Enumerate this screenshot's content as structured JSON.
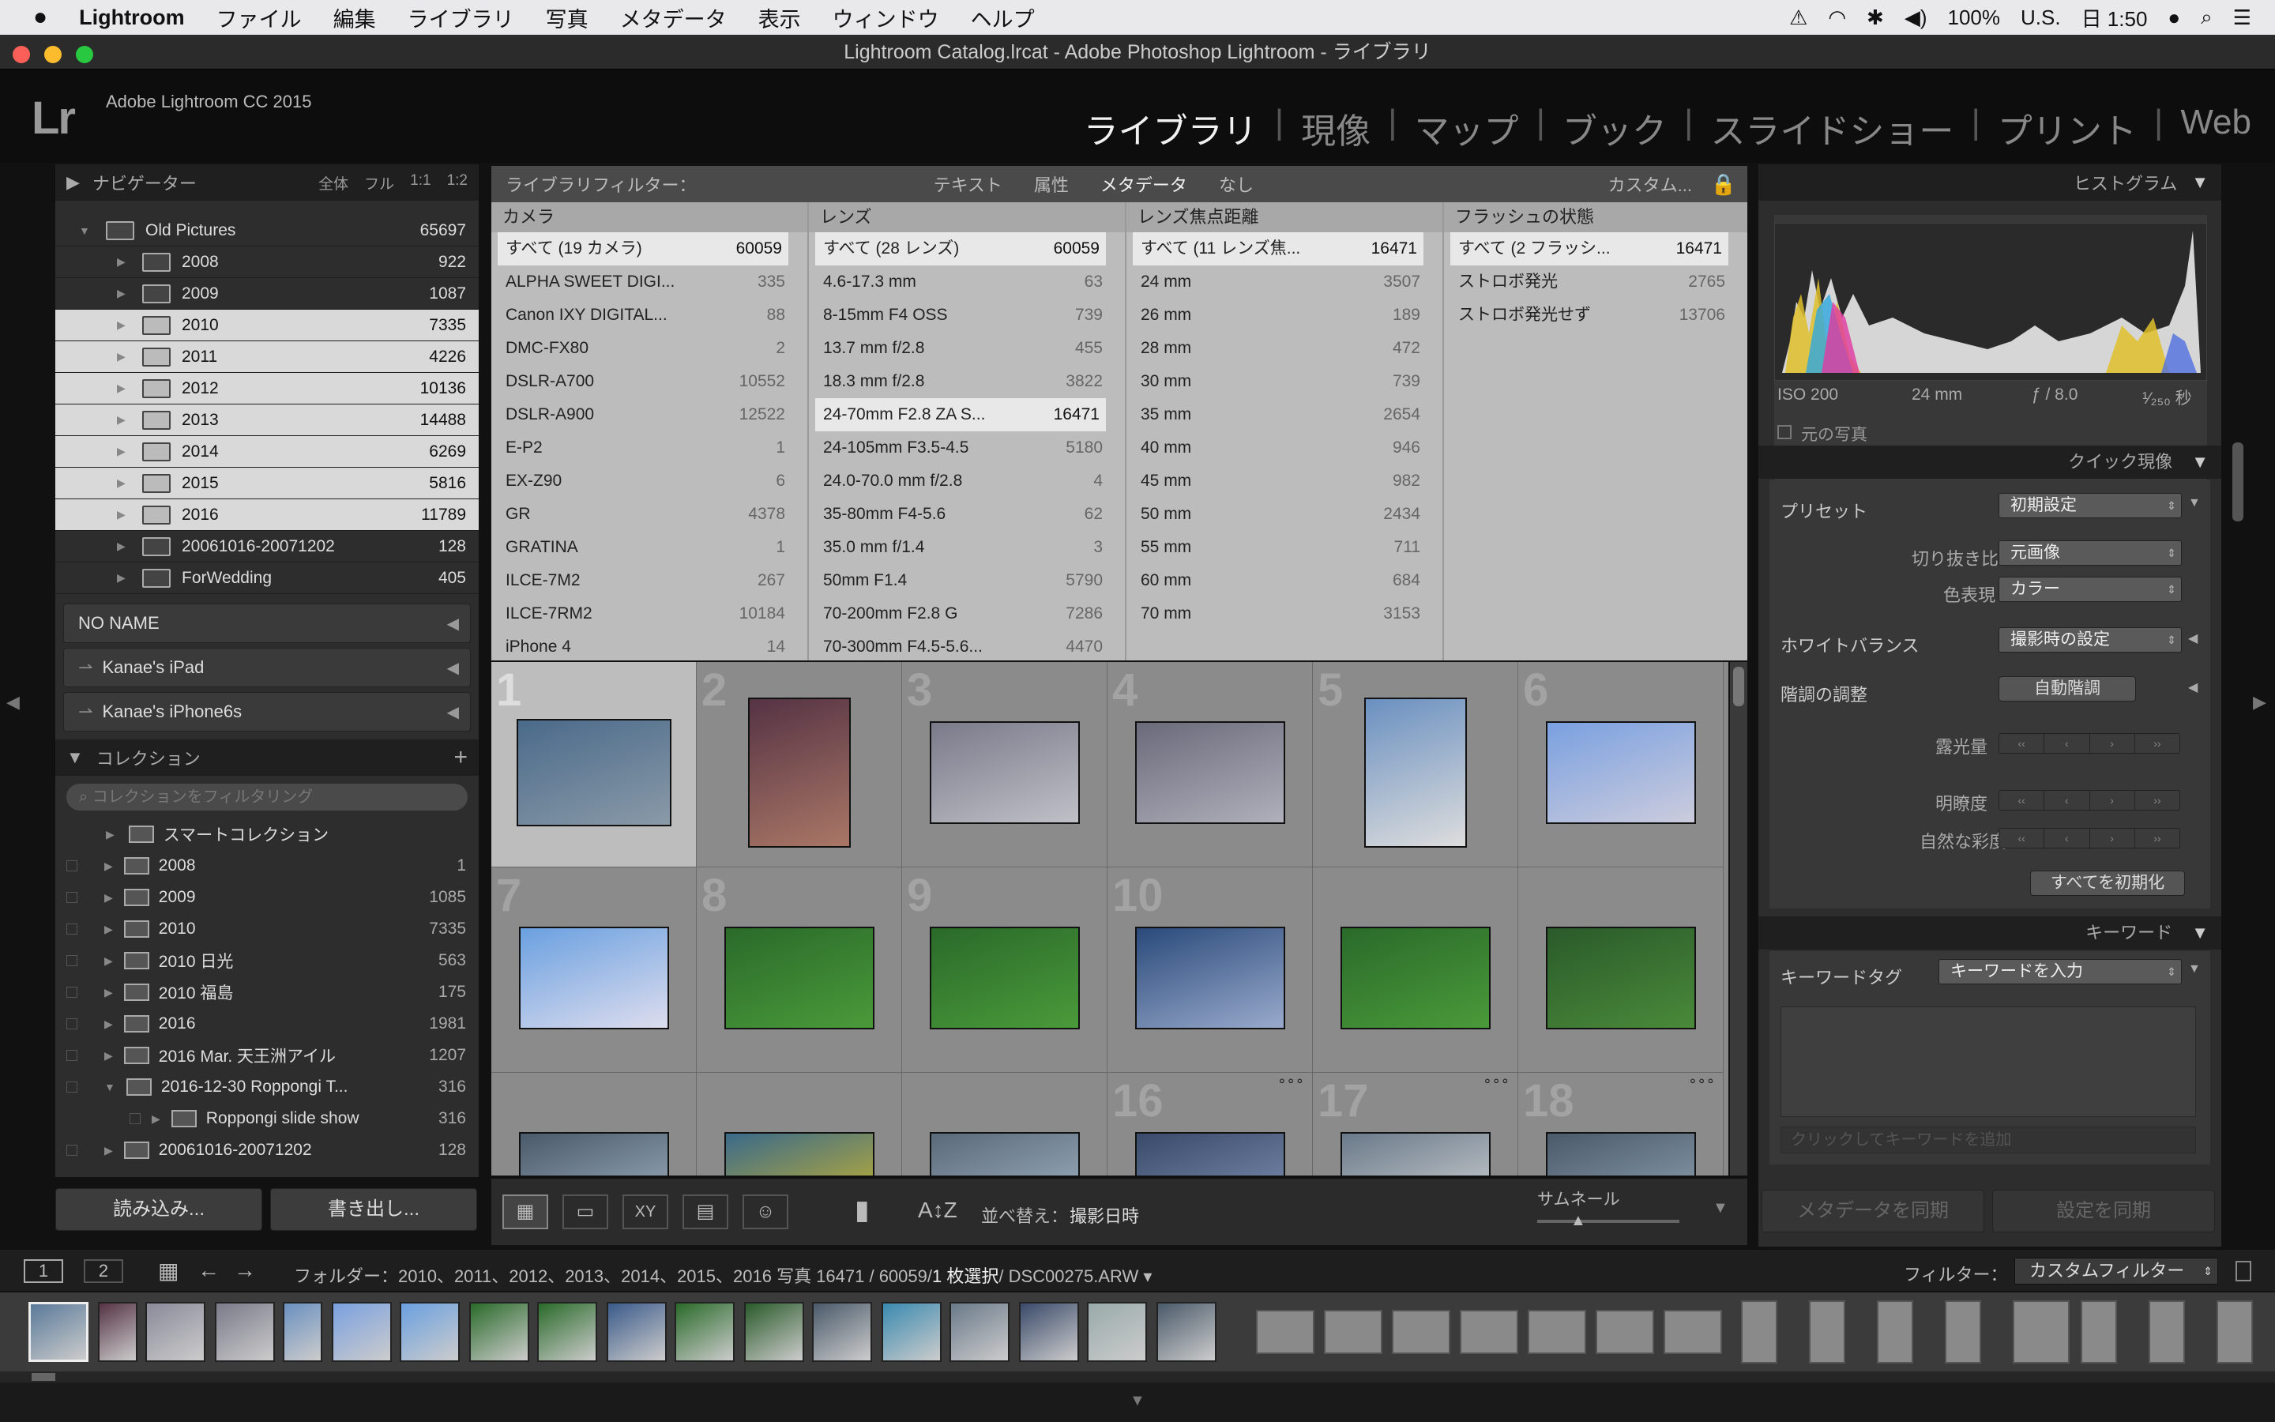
{
  "menubar": {
    "app": "Lightroom",
    "items": [
      "ファイル",
      "編集",
      "ライブラリ",
      "写真",
      "メタデータ",
      "表示",
      "ウィンドウ",
      "ヘルプ"
    ],
    "battery": "100%",
    "input": "U.S.",
    "clock": "日 1:50"
  },
  "window": {
    "title": "Lightroom Catalog.lrcat - Adobe Photoshop Lightroom - ライブラリ"
  },
  "header": {
    "logo": "Lr",
    "product": "Adobe Lightroom CC 2015",
    "modules": [
      "ライブラリ",
      "現像",
      "マップ",
      "ブック",
      "スライドショー",
      "プリント",
      "Web"
    ],
    "active_module": "ライブラリ"
  },
  "navigator": {
    "label": "ナビゲーター",
    "zoom": [
      "全体",
      "フル",
      "1:1",
      "1:2"
    ]
  },
  "folders": {
    "root": {
      "name": "Old Pictures",
      "count": "65697"
    },
    "items": [
      {
        "name": "2008",
        "count": "922",
        "hl": false
      },
      {
        "name": "2009",
        "count": "1087",
        "hl": false
      },
      {
        "name": "2010",
        "count": "7335",
        "hl": true
      },
      {
        "name": "2011",
        "count": "4226",
        "hl": true
      },
      {
        "name": "2012",
        "count": "10136",
        "hl": true
      },
      {
        "name": "2013",
        "count": "14488",
        "hl": true
      },
      {
        "name": "2014",
        "count": "6269",
        "hl": true
      },
      {
        "name": "2015",
        "count": "5816",
        "hl": true
      },
      {
        "name": "2016",
        "count": "11789",
        "hl": true
      },
      {
        "name": "20061016-20071202",
        "count": "128",
        "hl": false
      },
      {
        "name": "ForWedding",
        "count": "405",
        "hl": false
      }
    ],
    "volumes": [
      "NO NAME",
      "Kanae's iPad",
      "Kanae's iPhone6s"
    ]
  },
  "collections": {
    "label": "コレクション",
    "filter_placeholder": "コレクションをフィルタリング",
    "smart": "スマートコレクション",
    "items": [
      {
        "name": "2008",
        "count": "1"
      },
      {
        "name": "2009",
        "count": "1085"
      },
      {
        "name": "2010",
        "count": "7335"
      },
      {
        "name": "2010 日光",
        "count": "563"
      },
      {
        "name": "2010 福島",
        "count": "175"
      },
      {
        "name": "2016",
        "count": "1981"
      },
      {
        "name": "2016 Mar. 天王洲アイル",
        "count": "1207"
      },
      {
        "name": "2016-12-30 Roppongi T...",
        "count": "316"
      },
      {
        "name": "Roppongi slide show",
        "count": "316"
      },
      {
        "name": "20061016-20071202",
        "count": "128"
      }
    ]
  },
  "left_buttons": {
    "import": "読み込み...",
    "export": "書き出し..."
  },
  "filterbar": {
    "label": "ライブラリフィルター：",
    "tabs": [
      "テキスト",
      "属性",
      "メタデータ",
      "なし"
    ],
    "active": "メタデータ",
    "preset": "カスタム..."
  },
  "metadata": {
    "camera": {
      "header": "カメラ",
      "rows": [
        [
          "すべて (19 カメラ)",
          "60059"
        ],
        [
          "ALPHA SWEET DIGI...",
          "335"
        ],
        [
          "Canon IXY DIGITAL...",
          "88"
        ],
        [
          "DMC-FX80",
          "2"
        ],
        [
          "DSLR-A700",
          "10552"
        ],
        [
          "DSLR-A900",
          "12522"
        ],
        [
          "E-P2",
          "1"
        ],
        [
          "EX-Z90",
          "6"
        ],
        [
          "GR",
          "4378"
        ],
        [
          "GRATINA",
          "1"
        ],
        [
          "ILCE-7M2",
          "267"
        ],
        [
          "ILCE-7RM2",
          "10184"
        ],
        [
          "iPhone 4",
          "14"
        ]
      ]
    },
    "lens": {
      "header": "レンズ",
      "rows": [
        [
          "すべて (28 レンズ)",
          "60059"
        ],
        [
          "4.6-17.3 mm",
          "63"
        ],
        [
          "8-15mm F4 OSS",
          "739"
        ],
        [
          "13.7 mm f/2.8",
          "455"
        ],
        [
          "18.3 mm f/2.8",
          "3822"
        ],
        [
          "24-70mm F2.8 ZA S...",
          "16471"
        ],
        [
          "24-105mm F3.5-4.5",
          "5180"
        ],
        [
          "24.0-70.0 mm f/2.8",
          "4"
        ],
        [
          "35-80mm F4-5.6",
          "62"
        ],
        [
          "35.0 mm f/1.4",
          "3"
        ],
        [
          "50mm F1.4",
          "5790"
        ],
        [
          "70-200mm F2.8 G",
          "7286"
        ],
        [
          "70-300mm F4.5-5.6...",
          "4470"
        ]
      ]
    },
    "focal": {
      "header": "レンズ焦点距離",
      "rows": [
        [
          "すべて (11 レンズ焦...",
          "16471"
        ],
        [
          "24 mm",
          "3507"
        ],
        [
          "26 mm",
          "189"
        ],
        [
          "28 mm",
          "472"
        ],
        [
          "30 mm",
          "739"
        ],
        [
          "35 mm",
          "2654"
        ],
        [
          "40 mm",
          "946"
        ],
        [
          "45 mm",
          "982"
        ],
        [
          "50 mm",
          "2434"
        ],
        [
          "55 mm",
          "711"
        ],
        [
          "60 mm",
          "684"
        ],
        [
          "70 mm",
          "3153"
        ]
      ]
    },
    "flash": {
      "header": "フラッシュの状態",
      "rows": [
        [
          "すべて (2 フラッシ...",
          "16471"
        ],
        [
          "ストロボ発光",
          "2765"
        ],
        [
          "ストロボ発光せず",
          "13706"
        ]
      ]
    }
  },
  "grid_numbers": [
    "1",
    "2",
    "3",
    "4",
    "5",
    "6",
    "7",
    "8",
    "9",
    "10",
    "",
    "",
    "",
    "",
    "",
    "16",
    "17",
    "18"
  ],
  "toolbar": {
    "sort_label": "並べ替え：",
    "sort_value": "撮影日時",
    "thumb_label": "サムネール"
  },
  "right": {
    "histogram": "ヒストグラム",
    "exif": {
      "iso": "ISO 200",
      "focal": "24 mm",
      "aperture": "ƒ / 8.0",
      "shutter": "¹⁄₂₅₀ 秒"
    },
    "original": "元の写真",
    "quick_develop": "クイック現像",
    "preset_label": "プリセット",
    "preset_value": "初期設定",
    "crop_label": "切り抜き比",
    "crop_value": "元画像",
    "treatment_label": "色表現",
    "treatment_value": "カラー",
    "wb_label": "ホワイトバランス",
    "wb_value": "撮影時の設定",
    "tone_label": "階調の調整",
    "auto_tone": "自動階調",
    "exposure": "露光量",
    "clarity": "明瞭度",
    "vibrance": "自然な彩度",
    "reset_all": "すべてを初期化",
    "keywording": "キーワード",
    "keyword_tags": "キーワードタグ",
    "keyword_select": "キーワードを入力",
    "keyword_add_placeholder": "クリックしてキーワードを追加",
    "sync_meta": "メタデータを同期",
    "sync_settings": "設定を同期"
  },
  "filmbar": {
    "page1": "1",
    "page2": "2",
    "path": "フォルダー：2010、2011、2012、2013、2014、2015、2016  写真 16471 / 60059/",
    "selected": "1 枚選択",
    "file": "/ DSC00275.ARW",
    "filter_label": "フィルター：",
    "filter_value": "カスタムフィルター"
  },
  "colors": {
    "accent_sel": "#bdbdbd",
    "panel": "#2d2d2d",
    "header": "#0d0d0d"
  }
}
